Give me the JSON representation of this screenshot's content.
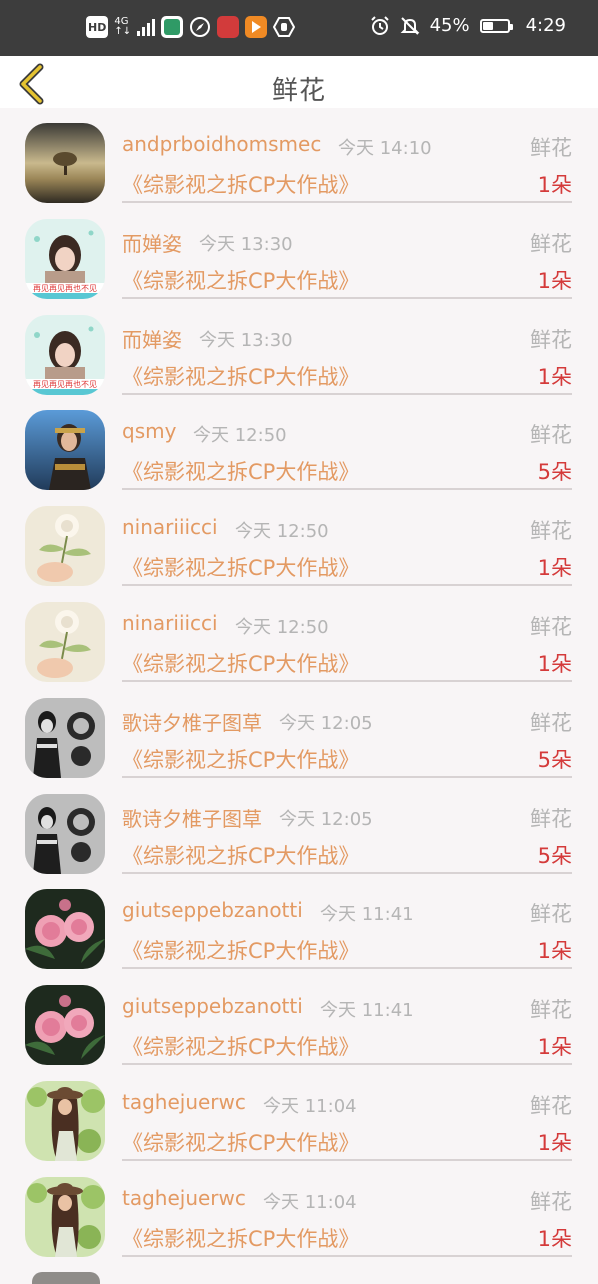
{
  "status_bar": {
    "hd": "HD",
    "net_top": "4G",
    "net_bottom": "↑↓",
    "battery_percent": "45%",
    "battery_level": 0.45,
    "time": "4:29"
  },
  "header": {
    "title": "鲜花"
  },
  "items": [
    {
      "name": "andprboidhomsmec",
      "time": "今天 14:10",
      "book": "《综影视之拆CP大作战》",
      "type": "鲜花",
      "count": "1朵",
      "avatar": "landscape-tree"
    },
    {
      "name": "而婵姿",
      "time": "今天 13:30",
      "book": "《综影视之拆CP大作战》",
      "type": "鲜花",
      "count": "1朵",
      "avatar": "girl-text"
    },
    {
      "name": "而婵姿",
      "time": "今天 13:30",
      "book": "《综影视之拆CP大作战》",
      "type": "鲜花",
      "count": "1朵",
      "avatar": "girl-text"
    },
    {
      "name": "qsmy",
      "time": "今天 12:50",
      "book": "《综影视之拆CP大作战》",
      "type": "鲜花",
      "count": "5朵",
      "avatar": "game-warrior"
    },
    {
      "name": "ninariiicci",
      "time": "今天 12:50",
      "book": "《综影视之拆CP大作战》",
      "type": "鲜花",
      "count": "1朵",
      "avatar": "hand-flower"
    },
    {
      "name": "ninariiicci",
      "time": "今天 12:50",
      "book": "《综影视之拆CP大作战》",
      "type": "鲜花",
      "count": "1朵",
      "avatar": "hand-flower"
    },
    {
      "name": "歌诗夕椎子图草",
      "time": "今天 12:05",
      "book": "《综影视之拆CP大作战》",
      "type": "鲜花",
      "count": "5朵",
      "avatar": "bw-portrait"
    },
    {
      "name": "歌诗夕椎子图草",
      "time": "今天 12:05",
      "book": "《综影视之拆CP大作战》",
      "type": "鲜花",
      "count": "5朵",
      "avatar": "bw-portrait"
    },
    {
      "name": "giutseppebzanotti",
      "time": "今天 11:41",
      "book": "《综影视之拆CP大作战》",
      "type": "鲜花",
      "count": "1朵",
      "avatar": "pink-roses"
    },
    {
      "name": "giutseppebzanotti",
      "time": "今天 11:41",
      "book": "《综影视之拆CP大作战》",
      "type": "鲜花",
      "count": "1朵",
      "avatar": "pink-roses"
    },
    {
      "name": "taghejuerwc",
      "time": "今天 11:04",
      "book": "《综影视之拆CP大作战》",
      "type": "鲜花",
      "count": "1朵",
      "avatar": "girl-hat-garden"
    },
    {
      "name": "taghejuerwc",
      "time": "今天 11:04",
      "book": "《综影视之拆CP大作战》",
      "type": "鲜花",
      "count": "1朵",
      "avatar": "girl-hat-garden"
    }
  ]
}
